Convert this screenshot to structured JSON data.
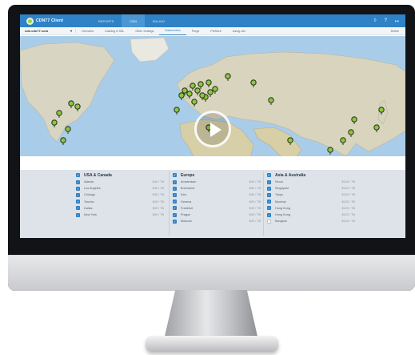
{
  "topbar": {
    "logo_text": "CDN77 Client",
    "tabs": [
      {
        "label": "REPORTS",
        "active": false
      },
      {
        "label": "CDN",
        "active": true
      },
      {
        "label": "BILLING",
        "active": false
      }
    ],
    "icons": [
      "wifi-icon",
      "help-icon",
      "logout-icon"
    ]
  },
  "subbar": {
    "domain": "cdn.cdn77.com",
    "tabs": [
      {
        "label": "Overview",
        "active": false
      },
      {
        "label": "Caching & SSL",
        "active": false
      },
      {
        "label": "Other Settings",
        "active": false
      },
      {
        "label": "Datacenters",
        "active": true
      },
      {
        "label": "Purge",
        "active": false
      },
      {
        "label": "Prefetch",
        "active": false
      },
      {
        "label": "Using cdn",
        "active": false
      }
    ],
    "right_action": "Delete"
  },
  "map": {
    "zoom_in": "+",
    "zoom_out": "−"
  },
  "locations": [
    {
      "region": "USA & Canada",
      "items": [
        {
          "city": "Atlanta",
          "price": "$49 / TB",
          "checked": true
        },
        {
          "city": "Los Angeles",
          "price": "$49 / TB",
          "checked": true
        },
        {
          "city": "Chicago",
          "price": "$49 / TB",
          "checked": true
        },
        {
          "city": "Toronto",
          "price": "$49 / TB",
          "checked": true
        },
        {
          "city": "Dallas",
          "price": "$49 / TB",
          "checked": true
        },
        {
          "city": "New York",
          "price": "$49 / TB",
          "checked": true
        }
      ]
    },
    {
      "region": "Europe",
      "items": [
        {
          "city": "Amsterdam",
          "price": "$49 / TB",
          "checked": true
        },
        {
          "city": "Bucharest",
          "price": "$49 / TB",
          "checked": true
        },
        {
          "city": "Kiev",
          "price": "$49 / TB",
          "checked": true
        },
        {
          "city": "Geneva",
          "price": "$49 / TB",
          "checked": true
        },
        {
          "city": "Frankfurt",
          "price": "$49 / TB",
          "checked": true
        },
        {
          "city": "Prague",
          "price": "$49 / TB",
          "checked": true
        },
        {
          "city": "Moscow",
          "price": "$49 / TB",
          "checked": true
        }
      ]
    },
    {
      "region": "Asia & Australia",
      "items": [
        {
          "city": "Seoul",
          "price": "$120 / TB",
          "checked": true
        },
        {
          "city": "Singapore",
          "price": "$120 / TB",
          "checked": true
        },
        {
          "city": "Tokyo",
          "price": "$120 / TB",
          "checked": true
        },
        {
          "city": "Mumbai",
          "price": "$120 / TB",
          "checked": true
        },
        {
          "city": "Hong Kong",
          "price": "$120 / TB",
          "checked": true
        },
        {
          "city": "Hong Kong",
          "price": "$120 / TB",
          "checked": true
        },
        {
          "city": "Bangkok",
          "price": "$120 / TB",
          "checked": false
        }
      ]
    }
  ],
  "colors": {
    "topbar": "#2f82c6",
    "marker": "#8ec63f",
    "checkbox": "#2f7fc4"
  }
}
